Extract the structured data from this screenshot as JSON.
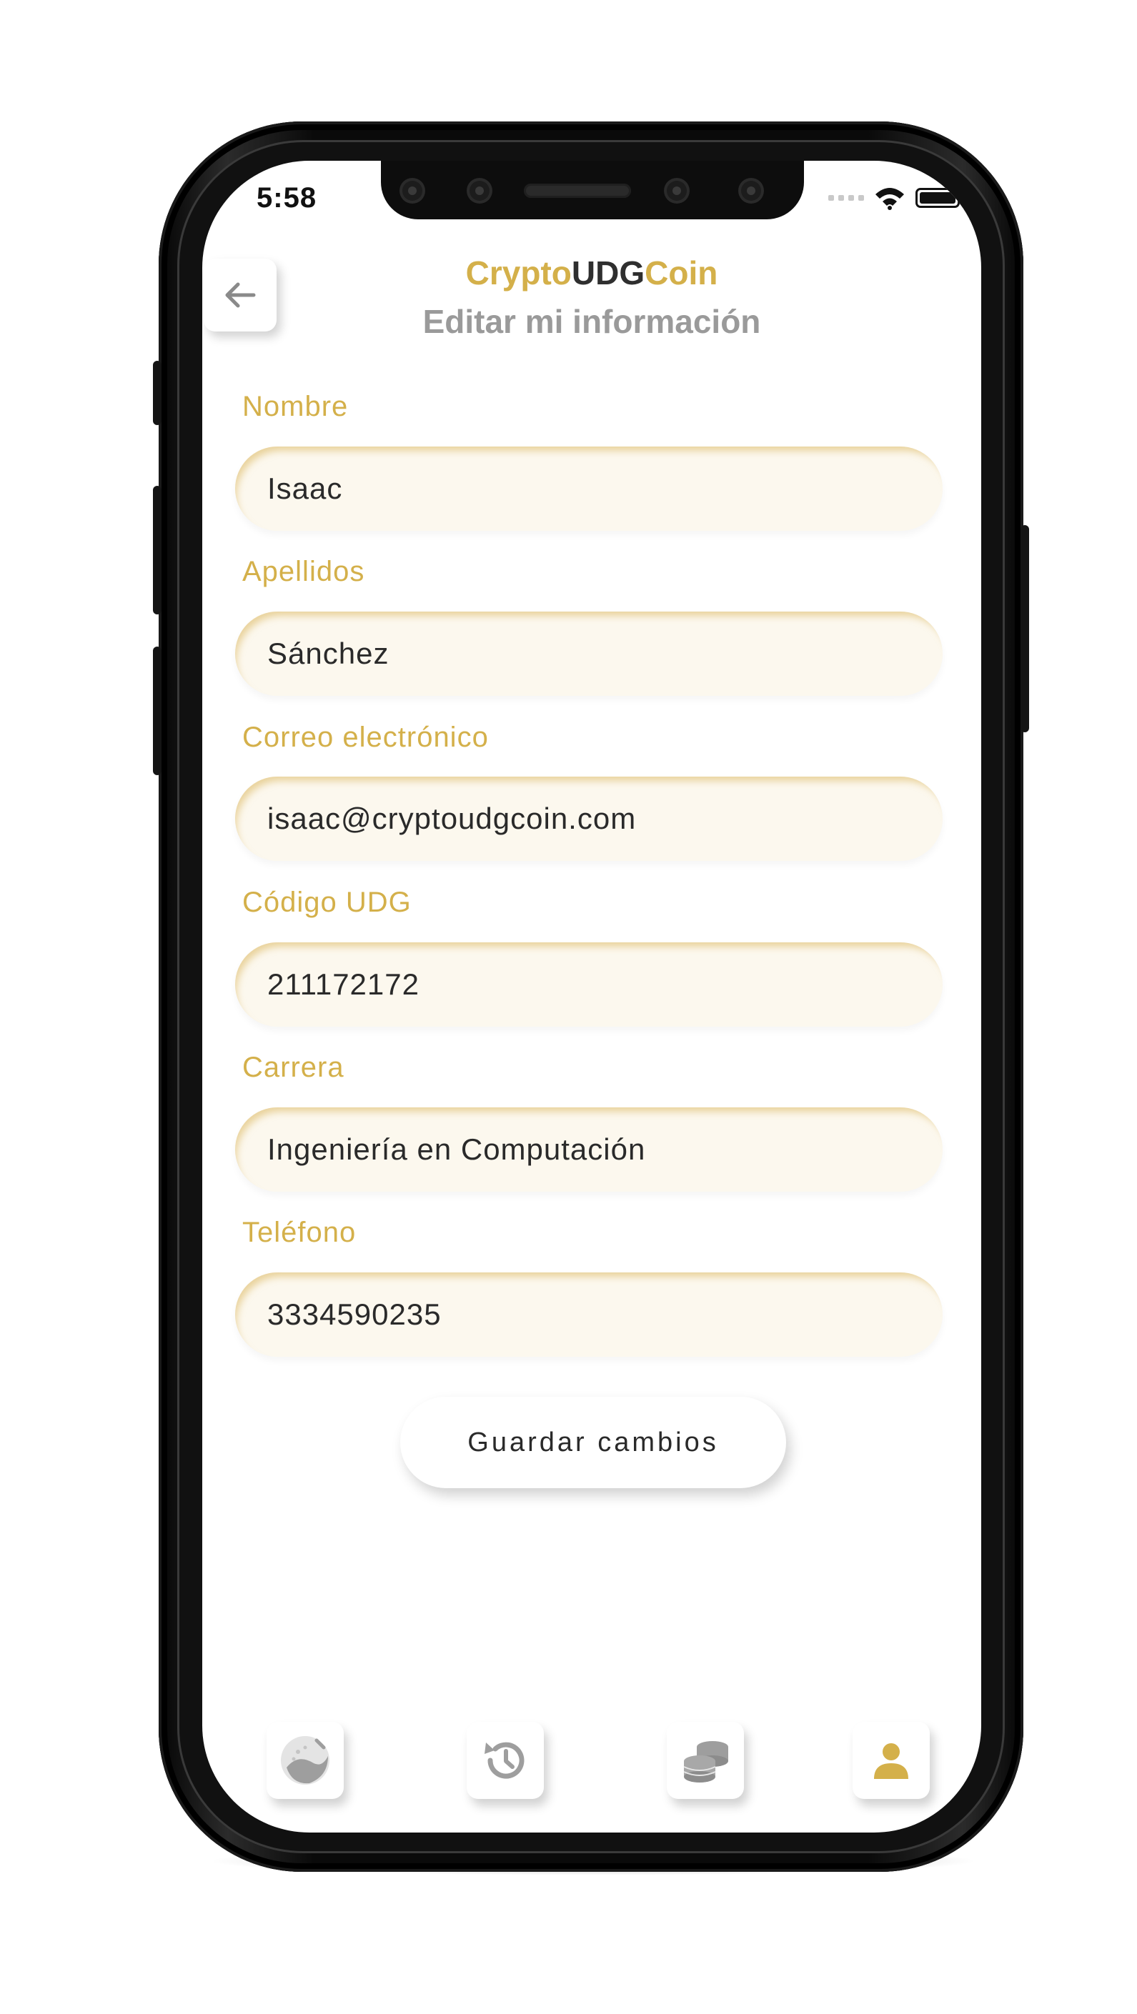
{
  "status_bar": {
    "time": "5:58"
  },
  "header": {
    "brand_part1": "Crypto",
    "brand_part2": "UDG",
    "brand_part3": "Coin",
    "subtitle": "Editar mi información"
  },
  "form": {
    "fields": [
      {
        "label": "Nombre",
        "value": "Isaac"
      },
      {
        "label": "Apellidos",
        "value": "Sánchez"
      },
      {
        "label": "Correo electrónico",
        "value": "isaac@cryptoudgcoin.com"
      },
      {
        "label": "Código UDG",
        "value": "211172172"
      },
      {
        "label": "Carrera",
        "value": "Ingeniería en Computación"
      },
      {
        "label": "Teléfono",
        "value": "3334590235"
      }
    ],
    "save_label": "Guardar cambios"
  },
  "bottom_nav": {
    "items": [
      {
        "icon": "wallet-globe-icon",
        "active": false
      },
      {
        "icon": "history-icon",
        "active": false
      },
      {
        "icon": "coins-stack-icon",
        "active": false
      },
      {
        "icon": "user-icon",
        "active": true
      }
    ]
  },
  "colors": {
    "accent": "#d4b04a",
    "field_bg": "#fcf8ee",
    "text": "#2a2a2a",
    "muted": "#9a9a9a",
    "icon_inactive": "#9e9e9e"
  }
}
